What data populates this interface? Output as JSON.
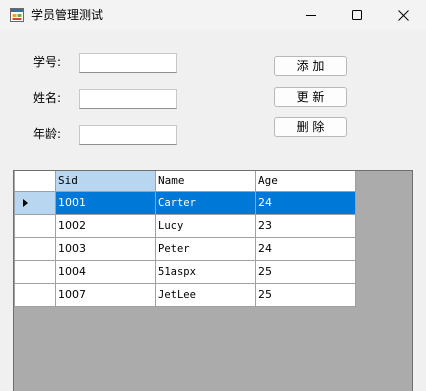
{
  "window": {
    "title": "学员管理测试"
  },
  "form": {
    "sid_label": "学号:",
    "name_label": "姓名:",
    "age_label": "年龄:",
    "sid_value": "",
    "name_value": "",
    "age_value": ""
  },
  "buttons": {
    "add_label": "添  加",
    "update_label": "更  新",
    "delete_label": "删  除"
  },
  "grid": {
    "columns": [
      "Sid",
      "Name",
      "Age"
    ],
    "rows": [
      {
        "sid": "1001",
        "name": "Carter",
        "age": "24"
      },
      {
        "sid": "1002",
        "name": "Lucy",
        "age": "23"
      },
      {
        "sid": "1003",
        "name": "Peter",
        "age": "24"
      },
      {
        "sid": "1004",
        "name": "51aspx",
        "age": "25"
      },
      {
        "sid": "1007",
        "name": "JetLee",
        "age": "25"
      }
    ],
    "selected_row_index": 0
  },
  "colors": {
    "selection": "#0078d7",
    "header_highlight": "#b8d6f0",
    "grid_background": "#ababab"
  },
  "icons": {
    "app": "app-window-icon",
    "minimize": "minimize-icon",
    "maximize": "maximize-icon",
    "close": "close-icon",
    "row_indicator": "row-pointer-icon"
  }
}
